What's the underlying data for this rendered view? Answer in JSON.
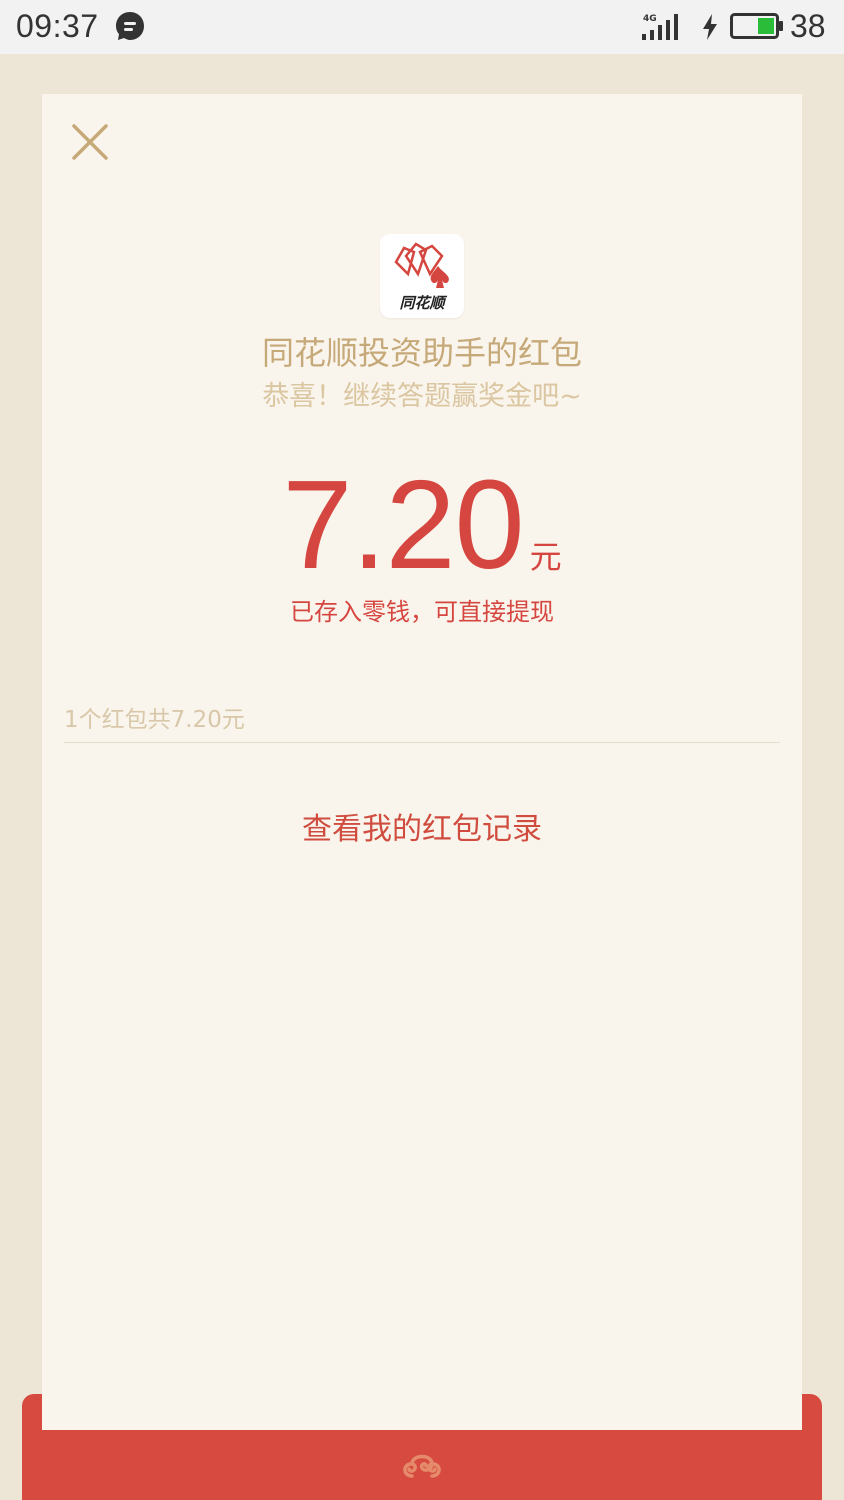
{
  "status_bar": {
    "time": "09:37",
    "network": "4G",
    "battery_level": "38",
    "icons": [
      "chat-bubble-icon",
      "signal-icon",
      "charging-bolt-icon",
      "battery-icon"
    ]
  },
  "packet": {
    "logo_text": "同花顺",
    "sender_title": "同花顺投资助手的红包",
    "wish": "恭喜！继续答题赢奖金吧~",
    "amount": "7.20",
    "unit": "元",
    "stored_note": "已存入零钱，可直接提现",
    "summary": "1个红包共7.20元",
    "records_link": "查看我的红包记录"
  },
  "colors": {
    "accent_red": "#d4463f",
    "gold_text": "#c6a979",
    "card_bg": "#faf5ec",
    "page_bg": "#ede6d6"
  }
}
